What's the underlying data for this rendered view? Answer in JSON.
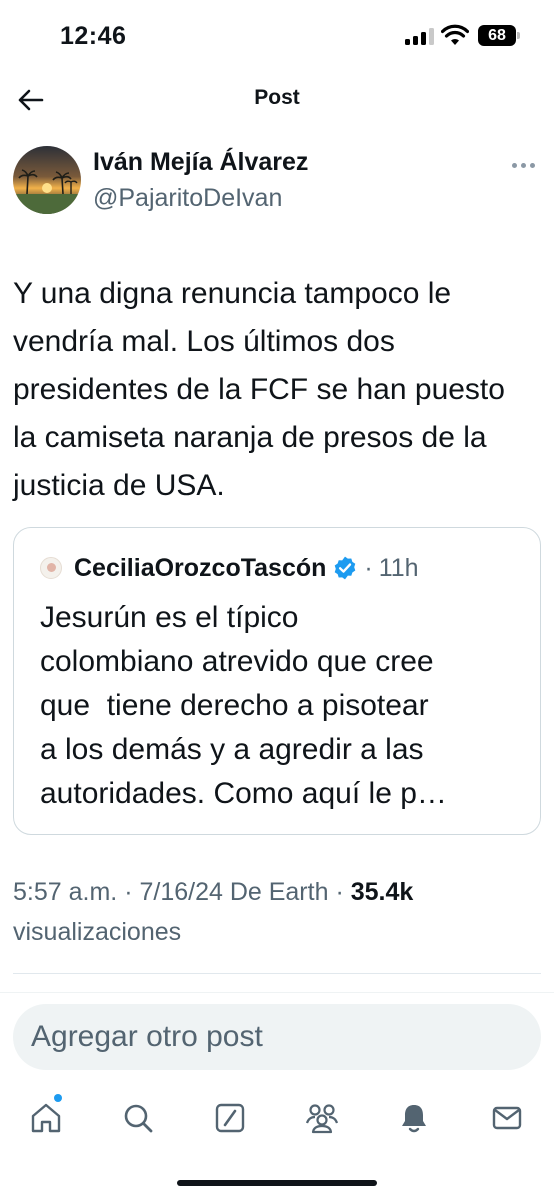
{
  "status_bar": {
    "time": "12:46",
    "battery": "68"
  },
  "header": {
    "title": "Post",
    "back_icon": "arrow-left-icon"
  },
  "author": {
    "name": "Iván Mejía Álvarez",
    "handle": "@PajaritoDeIvan",
    "avatar": "sunset-palm-trees-photo"
  },
  "post": {
    "lines": [
      "Y una digna renuncia tampoco le",
      "vendría mal. Los últimos dos",
      "presidentes de la FCF se han puesto",
      "la camiseta naranja de presos de la",
      "justicia de USA."
    ]
  },
  "quote": {
    "name": "CeciliaOrozcoTascón",
    "separator": "·",
    "time": "11h",
    "lines": [
      "Jesurún es el típico",
      "colombiano atrevido que cree",
      "que  tiene derecho a pisotear",
      "a los demás y a agredir a las",
      "autoridades. Como aquí le p…"
    ]
  },
  "meta": {
    "time": "5:57 a.m.",
    "sep1": "·",
    "date_source": "7/16/24 De Earth",
    "sep2": "·",
    "views": "35.4k",
    "views_label": "visualizaciones"
  },
  "reply": {
    "placeholder": "Agregar otro post"
  },
  "bottom_nav": {
    "items": [
      "home-icon",
      "search-icon",
      "grok-icon",
      "communities-icon",
      "notifications-icon",
      "messages-icon"
    ]
  },
  "colors": {
    "text": "#0f1419",
    "secondary": "#536471",
    "accent": "#1d9bf0",
    "input_bg": "#eff3f4"
  }
}
